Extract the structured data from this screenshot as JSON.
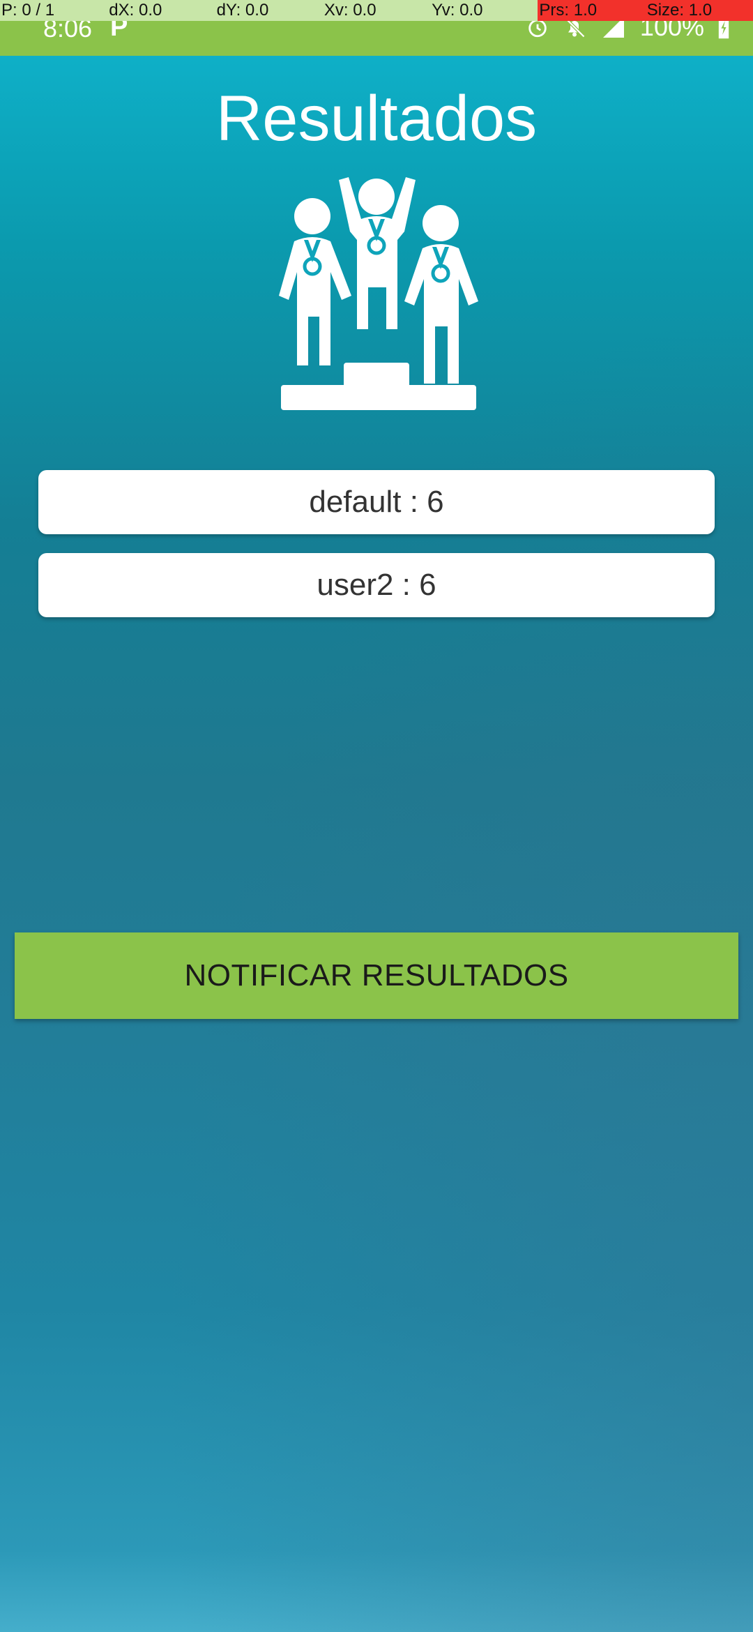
{
  "pointer_overlay": {
    "p": "P: 0 / 1",
    "dx": "dX: 0.0",
    "dy": "dY: 0.0",
    "xv": "Xv: 0.0",
    "yv": "Yv: 0.0",
    "prs": "Prs: 1.0",
    "size": "Size: 1.0"
  },
  "status_bar": {
    "time": "8:06",
    "notification_icon": "parking-p-icon",
    "battery": "100%",
    "icons": [
      "alarm-icon",
      "bell-off-icon",
      "signal-icon",
      "battery-charging-icon"
    ]
  },
  "page": {
    "title": "Resultados",
    "hero_icon": "podium-winners-icon"
  },
  "results": [
    {
      "label": "default : 6"
    },
    {
      "label": "user2 : 6"
    }
  ],
  "actions": {
    "notify_label": "NOTIFICAR RESULTADOS"
  },
  "colors": {
    "accent": "#8bc34a",
    "background_top": "#0fb6cf",
    "background_bottom": "#2c99b8",
    "card": "#ffffff"
  }
}
